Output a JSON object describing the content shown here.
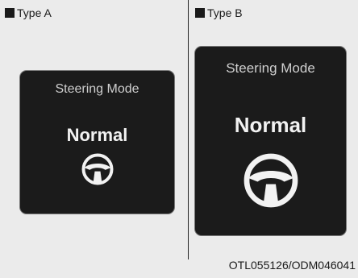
{
  "type_a": {
    "label": "Type A",
    "title": "Steering Mode",
    "mode": "Normal"
  },
  "type_b": {
    "label": "Type B",
    "title": "Steering Mode",
    "mode": "Normal"
  },
  "caption": "OTL055126/ODM046041",
  "icons": {
    "bullet": "black-square-icon",
    "wheel": "steering-wheel-icon"
  }
}
